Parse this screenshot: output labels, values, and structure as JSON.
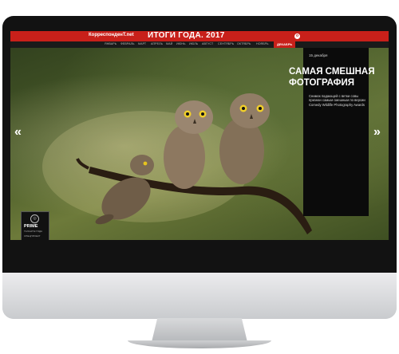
{
  "header": {
    "brand": "КорреспонденТ.net",
    "title": "ИТОГИ ГОДА. 2017",
    "logo_letter": "o"
  },
  "nav": {
    "items": [
      "ЯНВАРЬ",
      "ФЕВРАЛЬ",
      "МАРТ",
      "АПРЕЛЬ",
      "МАЙ",
      "ИЮНЬ",
      "ИЮЛЬ",
      "АВГУСТ",
      "СЕНТЯБРЬ",
      "ОКТЯБРЬ",
      "НОЯБРЬ"
    ],
    "active": "ДЕКАБРЬ"
  },
  "panel": {
    "date": "15 декабря",
    "headline": "САМАЯ СМЕШНАЯ ФОТОГРАФИЯ",
    "text": "Снимок падающей с ветки совы признан самым смешным по версии Comedy Wildlife Photography Awards"
  },
  "arrows": {
    "prev": "«",
    "next": "»"
  },
  "badge": {
    "title": "PRIME",
    "subtitle": "ТАЛАНТЫ ГОДА",
    "subtitle2": "СПЕЦПРОЕКТ"
  }
}
